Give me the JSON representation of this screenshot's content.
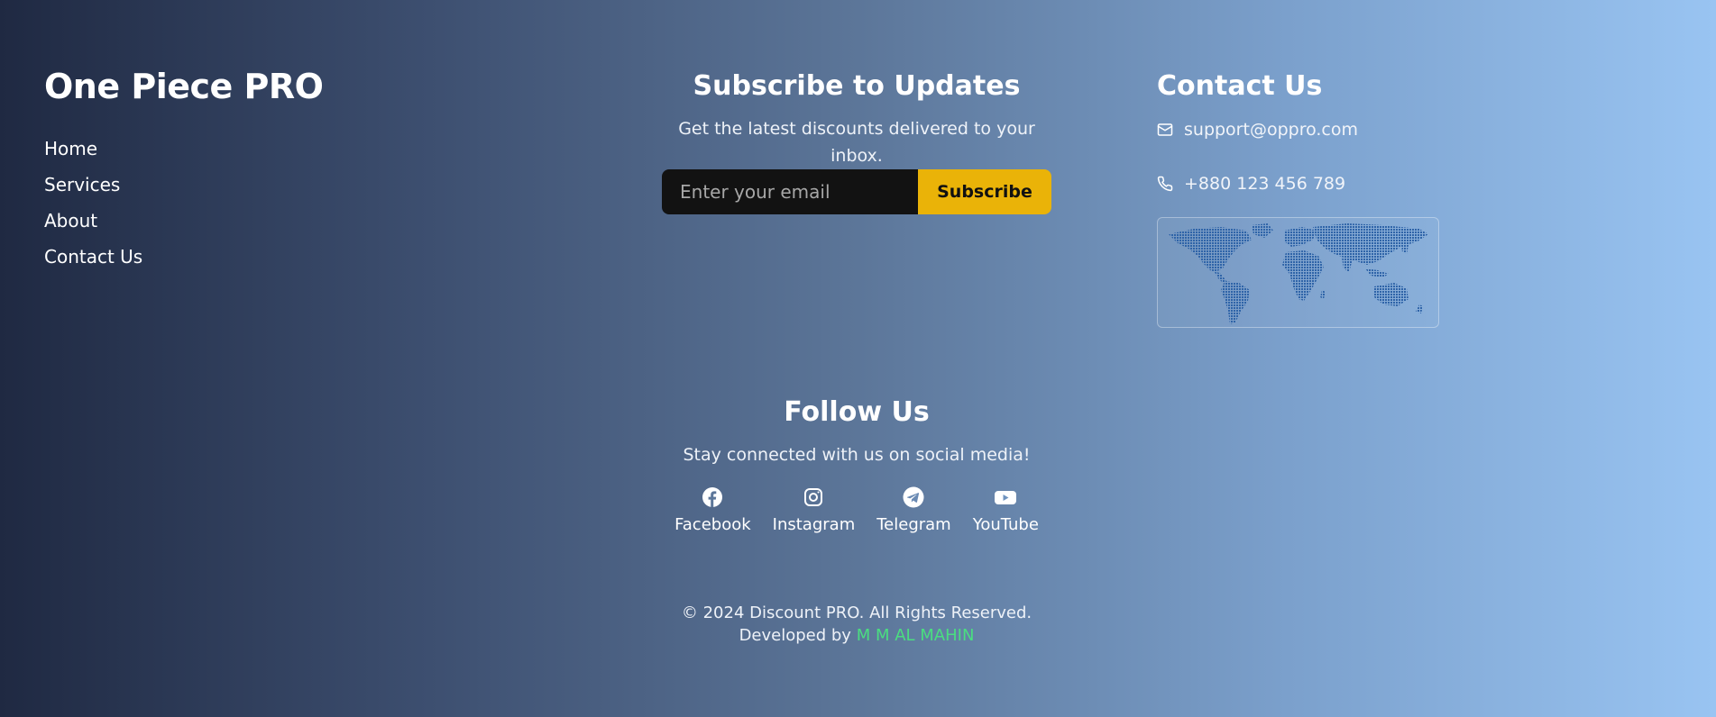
{
  "brand": {
    "name": "One Piece PRO"
  },
  "nav": {
    "items": [
      {
        "label": "Home"
      },
      {
        "label": "Services"
      },
      {
        "label": "About"
      },
      {
        "label": "Contact Us"
      }
    ]
  },
  "subscribe": {
    "title": "Subscribe to Updates",
    "description": "Get the latest discounts delivered to your inbox.",
    "email_placeholder": "Enter your email",
    "email_value": "",
    "button_label": "Subscribe"
  },
  "contact": {
    "title": "Contact Us",
    "email": "support@oppro.com",
    "phone": "+880 123 456 789",
    "email_icon": "mail-icon",
    "phone_icon": "phone-icon",
    "map_icon": "world-map"
  },
  "follow": {
    "title": "Follow Us",
    "description": "Stay connected with us on social media!",
    "socials": [
      {
        "label": "Facebook",
        "icon": "facebook-icon"
      },
      {
        "label": "Instagram",
        "icon": "instagram-icon"
      },
      {
        "label": "Telegram",
        "icon": "telegram-icon"
      },
      {
        "label": "YouTube",
        "icon": "youtube-icon"
      }
    ]
  },
  "footer": {
    "copyright": "© 2024 Discount PRO. All Rights Reserved.",
    "developed_prefix": "Developed by",
    "developer": "M M AL MAHIN"
  },
  "colors": {
    "accent_button": "#eab308",
    "developer_link": "#4ade80",
    "input_bg": "#121212",
    "gradient_start": "#1f2942",
    "gradient_end": "#99c4f2"
  }
}
